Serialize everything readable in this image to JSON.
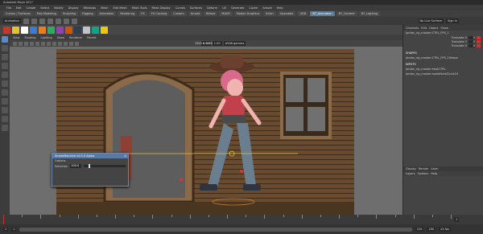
{
  "window": {
    "title": "Autodesk Maya 2017"
  },
  "menus": [
    "File",
    "Edit",
    "Create",
    "Select",
    "Modify",
    "Display",
    "Windows",
    "Mesh",
    "Edit Mesh",
    "Mesh Tools",
    "Mesh Display",
    "Curves",
    "Surfaces",
    "Deform",
    "UV",
    "Generate",
    "Cache",
    "Arnold",
    "Help"
  ],
  "shelf_tabs": [
    {
      "label": "Curves / Surfaces",
      "active": false
    },
    {
      "label": "Poly Modeling",
      "active": false
    },
    {
      "label": "Sculpting",
      "active": false
    },
    {
      "label": "Rigging",
      "active": false
    },
    {
      "label": "Animation",
      "active": false
    },
    {
      "label": "Rendering",
      "active": false
    },
    {
      "label": "FX",
      "active": false
    },
    {
      "label": "FX Caching",
      "active": false
    },
    {
      "label": "Custom",
      "active": false
    },
    {
      "label": "Arnold",
      "active": false
    },
    {
      "label": "Bifrost",
      "active": false
    },
    {
      "label": "MASH",
      "active": false
    },
    {
      "label": "Motion Graphics",
      "active": false
    },
    {
      "label": "XGen",
      "active": false
    },
    {
      "label": "Openable",
      "active": false
    },
    {
      "label": "UDD",
      "active": false
    },
    {
      "label": "BT_Animation",
      "active": true
    },
    {
      "label": "BT_Content",
      "active": false
    },
    {
      "label": "BT_Lighting",
      "active": false
    }
  ],
  "status": {
    "mode": "Animation",
    "sign_in": "Sign In",
    "symmetry": "No Live Surface"
  },
  "shelf_icon_colors": [
    "#c0392b",
    "#e5c12f",
    "#ffffff",
    "#3a7bd5",
    "#e67e22",
    "#27ae60",
    "#8e44ad",
    "#d35400",
    "#2c3e50",
    "#bdc3c7",
    "#16a085",
    "#f1c40f"
  ],
  "viewport": {
    "menu": [
      "View",
      "Shading",
      "Lighting",
      "Show",
      "Renderer",
      "Panels"
    ],
    "camera_label": "persp",
    "resolution": "1920 x 1080",
    "fields": {
      "near": "0.00",
      "far": "1.00",
      "color_space": "sRGB gamma"
    }
  },
  "channel_box": {
    "tabs": [
      "Channels",
      "Edit",
      "Object",
      "Show"
    ],
    "object_name": "jordan_rig_master:CTRL_FPS_1",
    "attrs": [
      {
        "name": "Translate X",
        "value": "0"
      },
      {
        "name": "Translate Y",
        "value": "0"
      },
      {
        "name": "Translate Z",
        "value": "0"
      }
    ],
    "shapes_title": "SHAPES",
    "shapes": [
      "jordan_rig_master:CTRL_FPS_1Shape"
    ],
    "inputs_title": "INPUTS",
    "inputs": [
      "jordan_rig_master:heatCTRL",
      "jordan_rig_master:makeNurbCircle24"
    ]
  },
  "layer_panel": {
    "tabs": [
      "Display",
      "Render",
      "Anim"
    ],
    "menu": [
      "Layers",
      "Options",
      "Help"
    ]
  },
  "dialog": {
    "title": "SmearMachine v0.5.0 Alpha",
    "menu": "Options",
    "label": "Selection",
    "value": "100.0",
    "slider_fraction": 0.12
  },
  "timeline": {
    "start": "1",
    "end": "120",
    "current": "1",
    "range_start": "1",
    "range_end": "200",
    "fps": "24 fps"
  }
}
